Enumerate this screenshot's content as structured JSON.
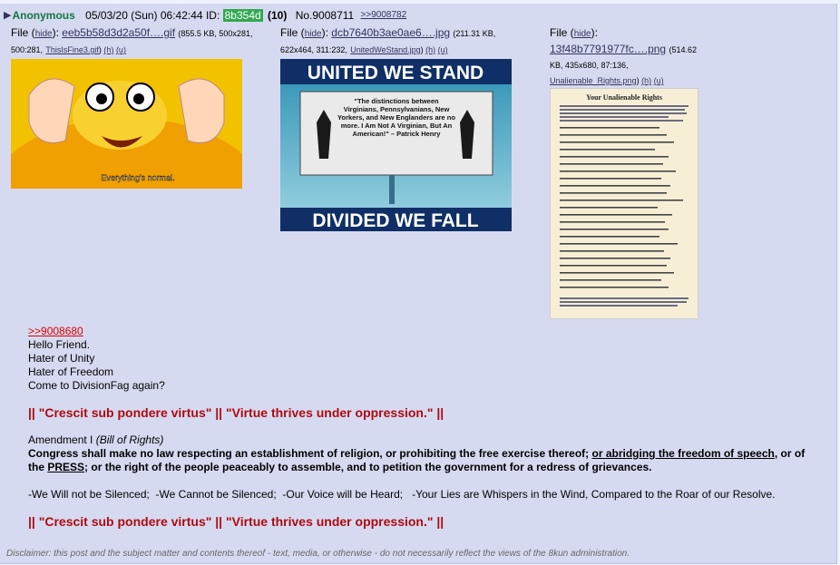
{
  "header": {
    "name": "Anonymous",
    "timestamp": "05/03/20 (Sun) 06:42:44",
    "id_label": "ID:",
    "id_value": "8b354d",
    "count": "(10)",
    "post_no": "No.9008711",
    "backlink": ">>9008782"
  },
  "files": [
    {
      "label": "File",
      "hide": "hide",
      "name": "eeb5b58d3d2a50f….gif",
      "meta": "(855.5 KB, 500x281, 500:281,",
      "orig_name": "ThisIsFine3.gif",
      "h": "(h)",
      "u": "(u)",
      "caption": "Everything's normal."
    },
    {
      "label": "File",
      "hide": "hide",
      "name": "dcb7640b3ae0ae6….jpg",
      "meta": "(211.31 KB, 622x464, 311:232,",
      "orig_name": "UnitedWeStand.jpg",
      "h": "(h)",
      "u": "(u)",
      "top_text": "UNITED WE STAND",
      "quote": "\"The distinctions between Virginians, Pennsylvanians, New Yorkers, and New Englanders are no more. I Am Not A Virginian, But An American!\" – Patrick Henry",
      "bottom_text": "DIVIDED WE FALL"
    },
    {
      "label": "File",
      "hide": "hide",
      "name": "13f48b7791977fc….png",
      "meta_a": "(514.62",
      "meta_b": "KB, 435x680, 87:136,",
      "orig_name": "Unalienable_Rights.png",
      "h": "(h)",
      "u": "(u)",
      "doc_title": "Your Unalienable Rights"
    }
  ],
  "body": {
    "quotelink": ">>9008680",
    "lines": [
      "Hello Friend.",
      "Hater of Unity",
      "Hater of Freedom",
      "Come to DivisionFag again?"
    ],
    "red_line": "|| \"Crescit sub pondere virtus\" || \"Virtue thrives under oppression.\" ||",
    "amend_title": "Amendment I",
    "amend_sub": "(Bill of Rights)",
    "amend_p1": "Congress shall make no law respecting an establishment of religion, or prohibiting the free exercise thereof;",
    "amend_u1": "or abridging the freedom of speech",
    "amend_p2": ", or of the",
    "amend_u2": "PRESS",
    "amend_p3": "; or the right of the people peaceably to assemble, and to petition the government for a redress of grievances.",
    "slogan": "-We Will not be Silenced;  -We Cannot be Silenced;  -Our Voice will be Heard;   -Your Lies are Whispers in the Wind, Compared to the Roar of our Resolve."
  },
  "disclaimer": "Disclaimer: this post and the subject matter and contents thereof - text, media, or otherwise - do not necessarily reflect the views of the 8kun administration."
}
